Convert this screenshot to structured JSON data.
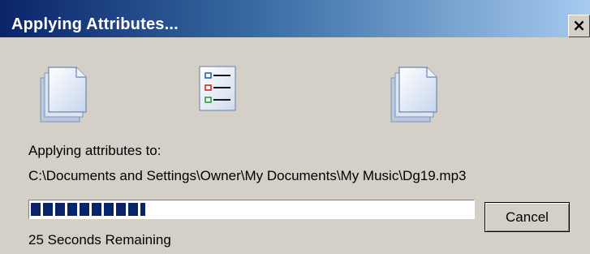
{
  "window": {
    "title": "Applying Attributes...",
    "close_label": "×"
  },
  "animation": {
    "source_icon": "documents-stack-icon",
    "middle_icon": "attributes-checklist-icon",
    "destination_icon": "documents-stack-icon"
  },
  "status": {
    "heading": "Applying attributes to:",
    "path": "C:\\Documents and Settings\\Owner\\My Documents\\My Music\\Dg19.mp3",
    "time_remaining": "25 Seconds Remaining"
  },
  "progress": {
    "percent": 26
  },
  "buttons": {
    "cancel_label": "Cancel"
  },
  "colors": {
    "title_bar_start": "#0a246a",
    "title_bar_end": "#a6caf0",
    "dialog_face": "#d4d0c8",
    "progress_block": "#0a246a"
  }
}
